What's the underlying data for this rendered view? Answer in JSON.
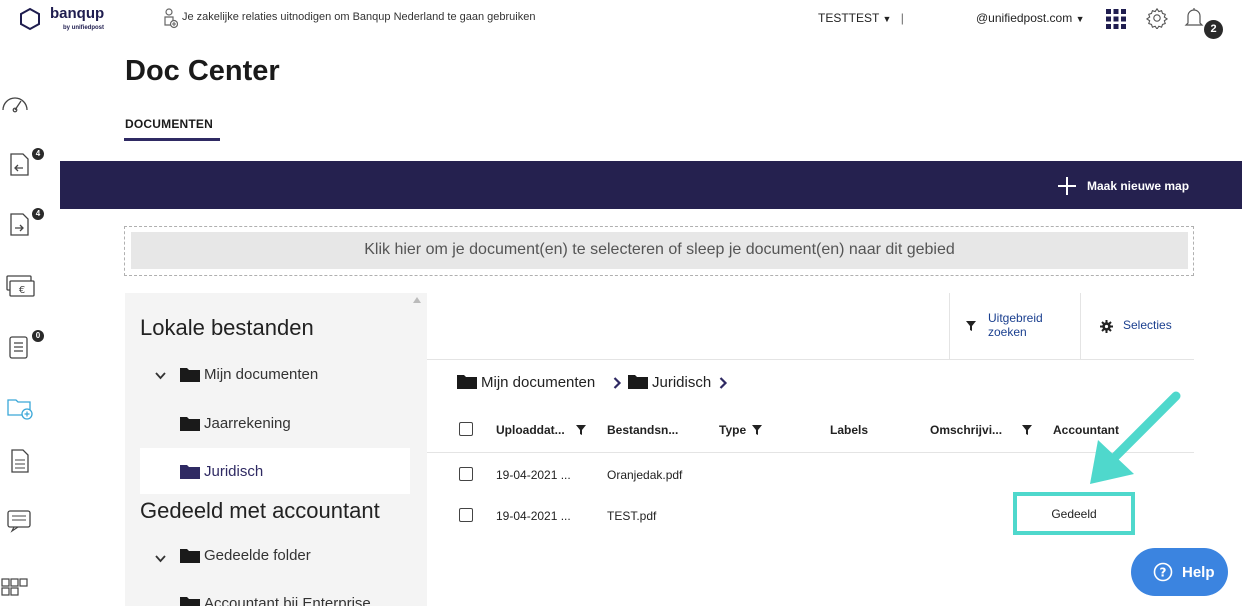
{
  "header": {
    "logo_text": "banqup",
    "logo_subtext": "by unifiedpost",
    "invite_text": "Je zakelijke relaties uitnodigen om Banqup Nederland te gaan gebruiken",
    "company_selector": "TESTTEST",
    "company_separator": "|",
    "user_email": "@unifiedpost.com",
    "notification_count": "2"
  },
  "sidebar": {
    "items": [
      {
        "icon": "dashboard-gauge-icon",
        "badge": ""
      },
      {
        "icon": "incoming-documents-icon",
        "badge": "4"
      },
      {
        "icon": "outgoing-documents-icon",
        "badge": "4"
      },
      {
        "icon": "payments-euro-icon",
        "badge": ""
      },
      {
        "icon": "tasks-list-icon",
        "badge": "0"
      },
      {
        "icon": "doc-center-folder-icon",
        "badge": "",
        "active": true
      },
      {
        "icon": "document-icon",
        "badge": ""
      },
      {
        "icon": "messages-icon",
        "badge": ""
      },
      {
        "icon": "apps-add-icon",
        "badge": ""
      }
    ]
  },
  "page": {
    "title": "Doc Center",
    "tab_documents": "DOCUMENTEN",
    "new_folder_label": "Maak nieuwe map",
    "dropzone_text": "Klik hier om je document(en) te selecteren of sleep je document(en) naar dit gebied"
  },
  "tree": {
    "local_heading": "Lokale bestanden",
    "my_documents": "Mijn documenten",
    "annual_accounts": "Jaarrekening",
    "legal": "Juridisch",
    "shared_heading": "Gedeeld met accountant",
    "shared_folder": "Gedeelde folder",
    "accountant_folder": "Accountant bij Enterprise"
  },
  "docs": {
    "advanced_search": "Uitgebreid zoeken",
    "selections": "Selecties",
    "breadcrumb": [
      "Mijn documenten",
      "Juridisch"
    ],
    "columns": {
      "upload_date": "Uploaddat...",
      "file_name": "Bestandsn...",
      "type": "Type",
      "labels": "Labels",
      "description": "Omschrijvi...",
      "accountant": "Accountant"
    },
    "rows": [
      {
        "upload_date": "19-04-2021 ...",
        "file_name": "Oranjedak.pdf",
        "accountant": ""
      },
      {
        "upload_date": "19-04-2021 ...",
        "file_name": "TEST.pdf",
        "accountant": "Gedeeld"
      }
    ]
  },
  "help": {
    "label": "Help"
  },
  "colors": {
    "navy": "#25214f",
    "highlight_teal": "#4fd8cc",
    "help_blue": "#3b84e0",
    "link_blue": "#1a3f8f"
  }
}
